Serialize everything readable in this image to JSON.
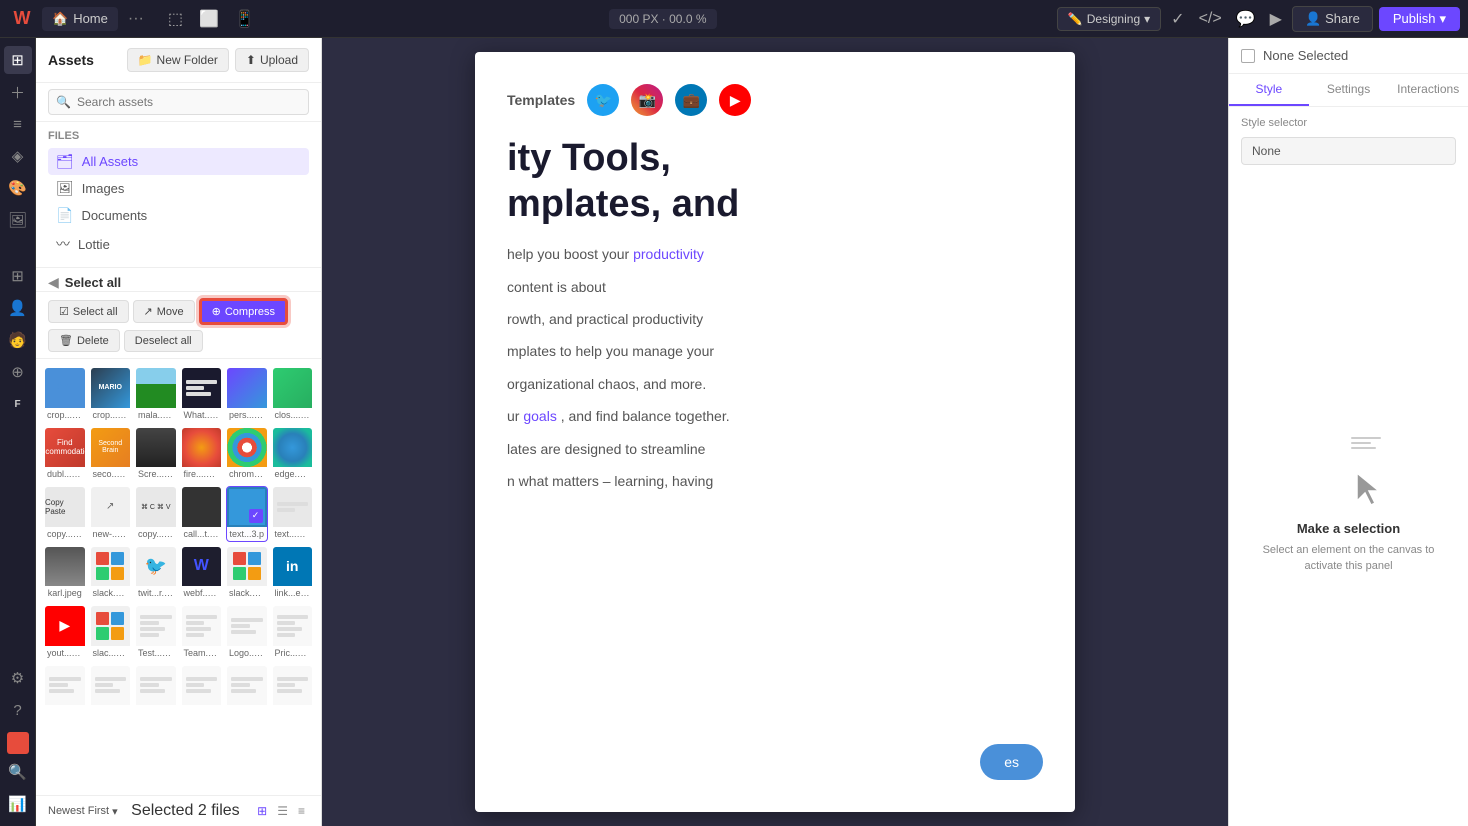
{
  "topbar": {
    "home_label": "Home",
    "dots": "···",
    "dims": "000 PX · 00.0 %",
    "designing_label": "Designing",
    "share_label": "Share",
    "publish_label": "Publish"
  },
  "assets_panel": {
    "title": "Assets",
    "new_folder_label": "New Folder",
    "upload_label": "Upload",
    "search_placeholder": "Search assets",
    "nav": {
      "files_title": "Files",
      "items": [
        {
          "id": "all-assets",
          "label": "All Assets",
          "active": true
        },
        {
          "id": "images",
          "label": "Images",
          "active": false
        },
        {
          "id": "documents",
          "label": "Documents",
          "active": false
        },
        {
          "id": "lottie",
          "label": "Lottie",
          "active": false
        }
      ]
    },
    "toolbar": {
      "select_all": "Select all",
      "move_label": "Move",
      "compress_label": "Compress",
      "delete_label": "Delete",
      "deselect_all": "Deselect all"
    },
    "assets": [
      {
        "name": "crop....webp",
        "type": "crop",
        "selected": false
      },
      {
        "name": "crop....webp",
        "type": "crop2",
        "selected": false
      },
      {
        "name": "mala....webp",
        "type": "mala",
        "selected": false
      },
      {
        "name": "What...s.jpg",
        "type": "whatjs",
        "selected": false
      },
      {
        "name": "pers...1.jpg",
        "type": "pers",
        "selected": false
      },
      {
        "name": "clos....webp",
        "type": "clos",
        "selected": false
      },
      {
        "name": "dubl...webp",
        "type": "dubl",
        "selected": false
      },
      {
        "name": "seco....webp",
        "type": "seco",
        "selected": false
      },
      {
        "name": "Scre....webp",
        "type": "scre",
        "selected": false
      },
      {
        "name": "fire....webp",
        "type": "fire",
        "selected": false
      },
      {
        "name": "chrome.png",
        "type": "chrome",
        "selected": false
      },
      {
        "name": "edge.png",
        "type": "edge",
        "selected": false
      },
      {
        "name": "copy...e.png",
        "type": "copy",
        "selected": false
      },
      {
        "name": "new-...n.svg",
        "type": "new",
        "selected": false
      },
      {
        "name": "copy...e.s",
        "type": "copys",
        "selected": false
      },
      {
        "name": "call...t.svg",
        "type": "call",
        "selected": false
      },
      {
        "name": "text...3.p",
        "type": "text3p",
        "selected": true
      },
      {
        "name": "text...3.png",
        "type": "text3",
        "selected": false
      },
      {
        "name": "karl.jpeg",
        "type": "karl",
        "selected": false
      },
      {
        "name": "slack.svg",
        "type": "slack",
        "selected": false
      },
      {
        "name": "twit...r.png",
        "type": "twit",
        "selected": false
      },
      {
        "name": "webf...w.png",
        "type": "webf",
        "selected": false
      },
      {
        "name": "slack.png",
        "type": "slackpng",
        "selected": false
      },
      {
        "name": "link...e.png",
        "type": "link",
        "selected": false
      },
      {
        "name": "yout...e.png",
        "type": "yt",
        "selected": false
      },
      {
        "name": "slac...1.png",
        "type": "slac1",
        "selected": false
      },
      {
        "name": "Test...s.png",
        "type": "test",
        "selected": false
      },
      {
        "name": "Team...s.png",
        "type": "team",
        "selected": false
      },
      {
        "name": "Logo...s.png",
        "type": "logo",
        "selected": false
      },
      {
        "name": "Pric...s.png",
        "type": "pric",
        "selected": false
      },
      {
        "name": "",
        "type": "templ1",
        "selected": false
      },
      {
        "name": "",
        "type": "templ2",
        "selected": false
      },
      {
        "name": "",
        "type": "templ3",
        "selected": false
      },
      {
        "name": "",
        "type": "templ4",
        "selected": false
      },
      {
        "name": "",
        "type": "templ5",
        "selected": false
      },
      {
        "name": "",
        "type": "templ6",
        "selected": false
      }
    ],
    "footer": {
      "sort_label": "Newest First",
      "selected_info": "Selected 2 files"
    }
  },
  "canvas": {
    "templates_label": "Templates",
    "heading": "ity Tools,\nmplates, and",
    "body1": "help you boost your",
    "productivity_link": "productivity",
    "body2": "content is about",
    "body3": "rowth, and practical productivity",
    "body4": "mplates to help you manage your",
    "body5": "organizational chaos, and more.",
    "body6": "ur",
    "goals_link": "goals",
    "body7": ", and find balance together.",
    "body8": "lates are designed to streamline",
    "body9": "n what matters – learning, having",
    "cta_label": "es"
  },
  "right_panel": {
    "none_selected": "None Selected",
    "tabs": [
      "Style",
      "Settings",
      "Interactions"
    ],
    "active_tab": "Style",
    "style_selector_label": "Style selector",
    "style_selector_value": "None",
    "make_selection_title": "Make a selection",
    "make_selection_desc": "Select an element on the canvas to activate this panel"
  }
}
